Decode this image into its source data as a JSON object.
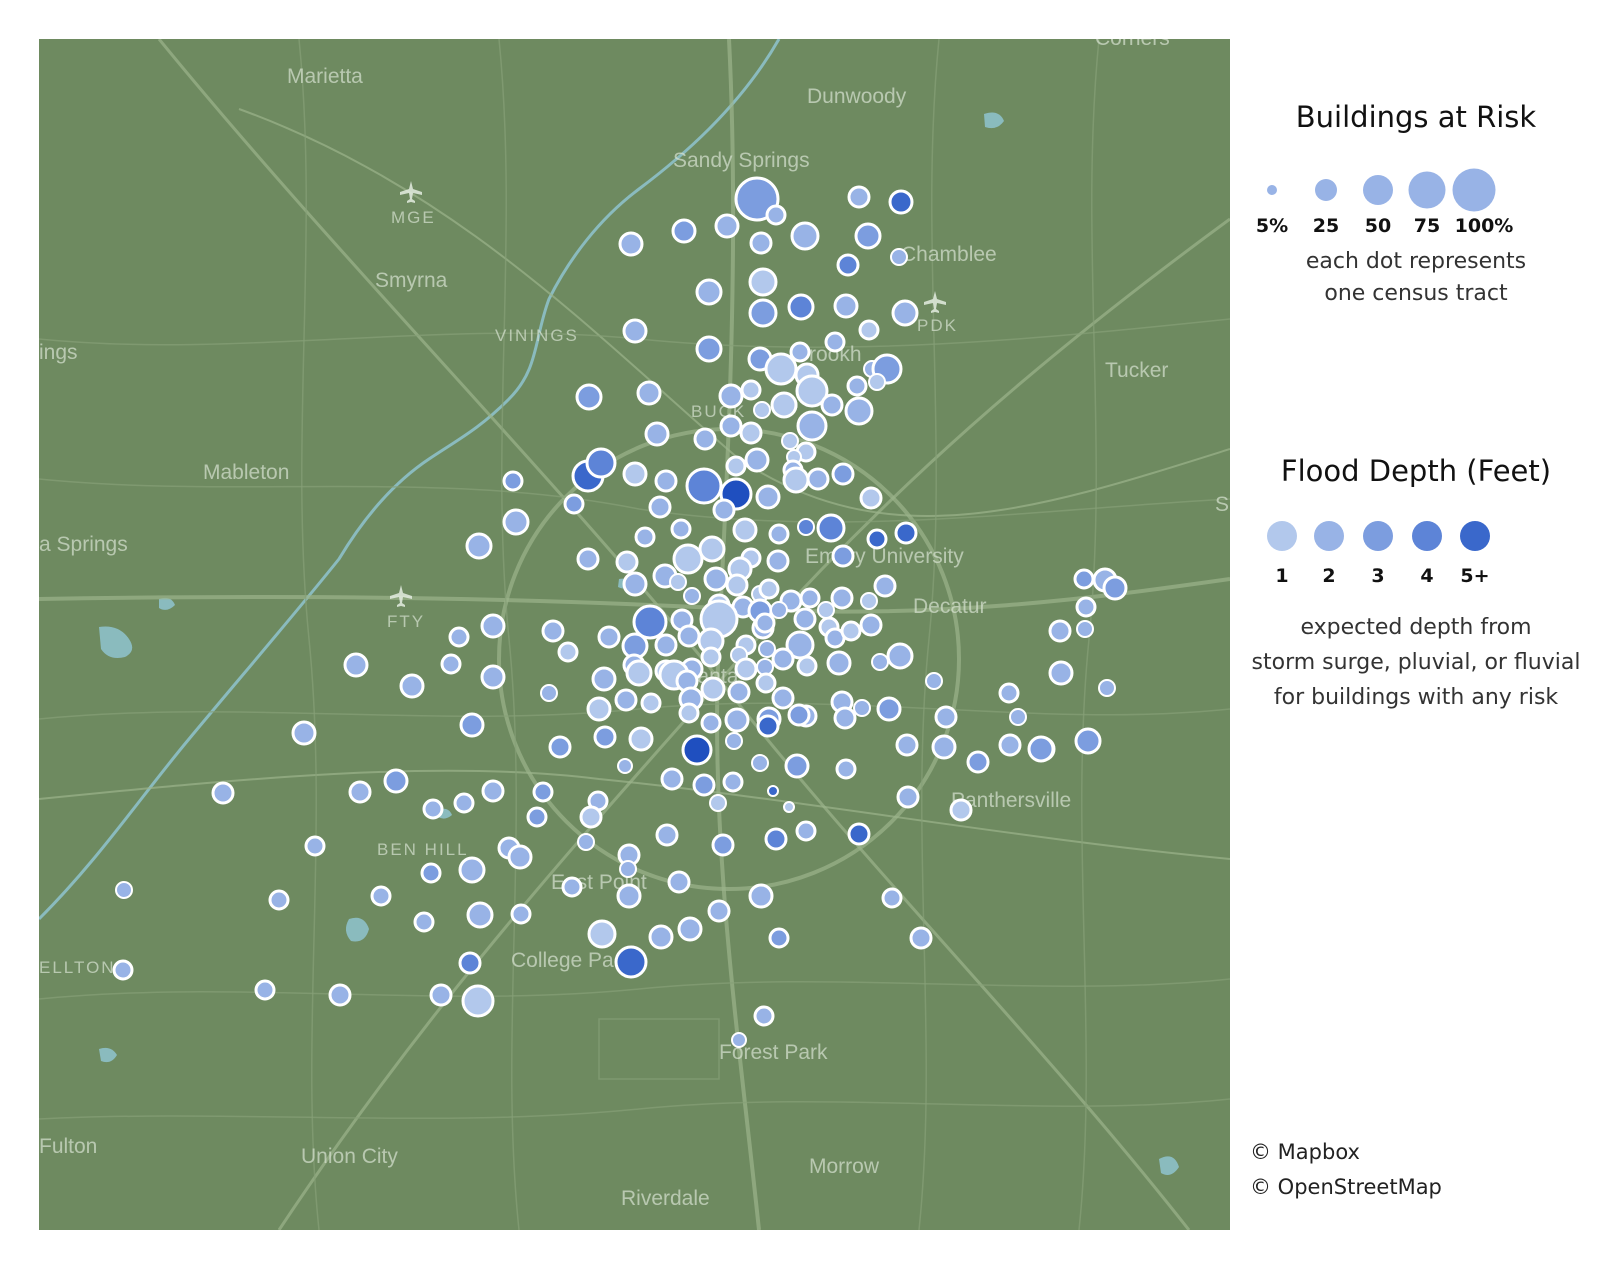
{
  "colors": {
    "land": "#6e8a60",
    "road": "#9bb38c",
    "road_minor": "#86a078",
    "water": "#8fc3cf",
    "dot_stroke": "#ffffff",
    "depth": [
      "#b2c8ec",
      "#98b3e6",
      "#7c9ddf",
      "#5d84d7",
      "#3a68cb",
      "#1f4fbf"
    ]
  },
  "map_labels": [
    {
      "id": "marietta",
      "text": "Marietta"
    },
    {
      "id": "dunwoody",
      "text": "Dunwoody"
    },
    {
      "id": "sandy-springs",
      "text": "Sandy Springs"
    },
    {
      "id": "mge",
      "text": "MGE"
    },
    {
      "id": "chamblee",
      "text": "Chamblee"
    },
    {
      "id": "smyrna",
      "text": "Smyrna"
    },
    {
      "id": "pdk",
      "text": "PDK"
    },
    {
      "id": "vinings",
      "text": "VININGS"
    },
    {
      "id": "ings",
      "text": "ings"
    },
    {
      "id": "brookhaven",
      "text": "Brookh"
    },
    {
      "id": "tucker",
      "text": "Tucker"
    },
    {
      "id": "buckhead",
      "text": "BUCK"
    },
    {
      "id": "mableton",
      "text": "Mableton"
    },
    {
      "id": "emory",
      "text": "Emory University"
    },
    {
      "id": "a-springs",
      "text": "a Springs"
    },
    {
      "id": "fty",
      "text": "FTY"
    },
    {
      "id": "decatur",
      "text": "Decatur"
    },
    {
      "id": "atlanta",
      "text": "Atlanta"
    },
    {
      "id": "panthersville",
      "text": "Panthersville"
    },
    {
      "id": "ben-hill",
      "text": "BEN HILL"
    },
    {
      "id": "east-point",
      "text": "East Point"
    },
    {
      "id": "college-park",
      "text": "College Pa"
    },
    {
      "id": "elton",
      "text": "ELLTON"
    },
    {
      "id": "forest-park",
      "text": "Forest Park"
    },
    {
      "id": "fulton",
      "text": "Fulton"
    },
    {
      "id": "union-city",
      "text": "Union City"
    },
    {
      "id": "morrow",
      "text": "Morrow"
    },
    {
      "id": "riverdale",
      "text": "Riverdale"
    },
    {
      "id": "corners",
      "text": "Corners"
    },
    {
      "id": "s-edge",
      "text": "S"
    }
  ],
  "legend_size": {
    "title": "Buildings at Risk",
    "items": [
      {
        "label": "5%",
        "value": 5
      },
      {
        "label": "25",
        "value": 25
      },
      {
        "label": "50",
        "value": 50
      },
      {
        "label": "75",
        "value": 75
      },
      {
        "label": "100%",
        "value": 100
      }
    ],
    "description_line1": "each dot represents",
    "description_line2": "one census tract"
  },
  "legend_depth": {
    "title": "Flood Depth (Feet)",
    "items": [
      {
        "label": "1",
        "level": 1
      },
      {
        "label": "2",
        "level": 2
      },
      {
        "label": "3",
        "level": 3
      },
      {
        "label": "4",
        "level": 4
      },
      {
        "label": "5+",
        "level": 5
      }
    ],
    "description_line1": "expected depth from",
    "description_line2": "storm surge, pluvial, or fluvial",
    "description_line3": "for buildings with any risk"
  },
  "attribution": {
    "mapbox": "© Mapbox",
    "osm": "© OpenStreetMap"
  }
}
